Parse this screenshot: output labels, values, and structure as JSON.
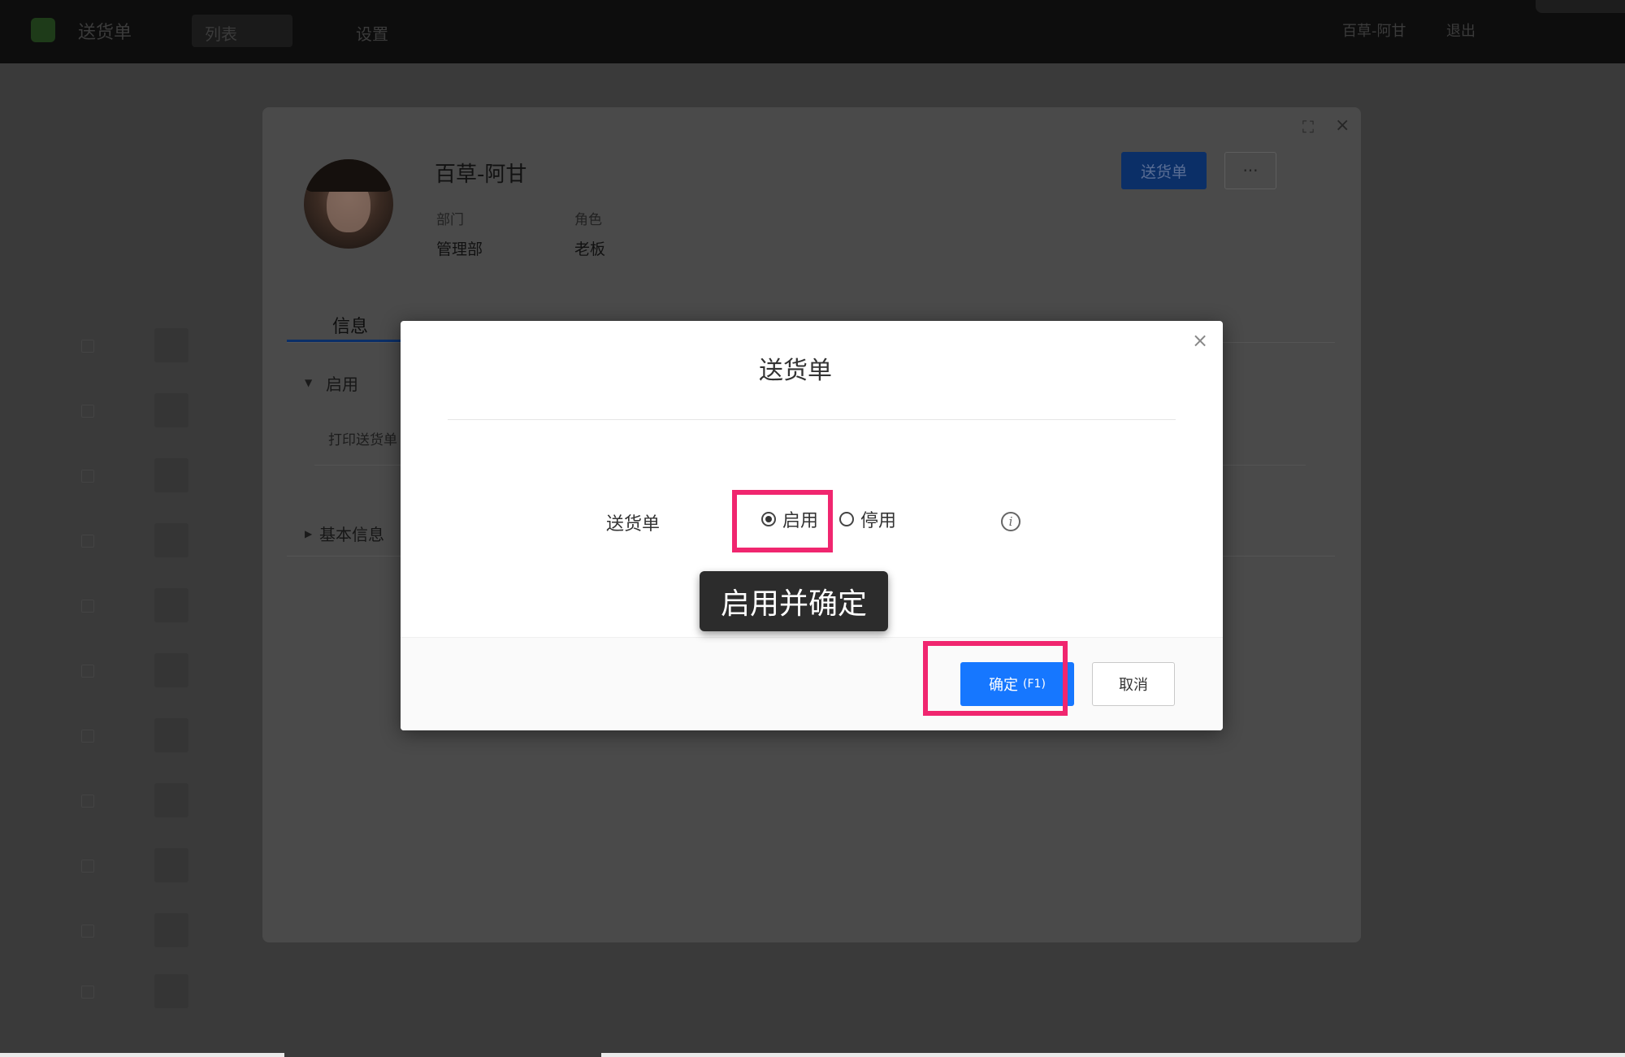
{
  "app": {
    "name": "送货单",
    "tabs": [
      "列表",
      "设置"
    ],
    "user": "百草-阿甘",
    "logout": "退出"
  },
  "panel": {
    "name": "百草-阿甘",
    "department_label": "部门",
    "department_value": "管理部",
    "role_label": "角色",
    "role_value": "老板",
    "primary_button": "送货单",
    "more_button": "···",
    "tab": "信息",
    "section_enabled": "启用",
    "item_print": "打印送货单",
    "section_basic": "基本信息"
  },
  "modal": {
    "title": "送货单",
    "close": "×",
    "field_label": "送货单",
    "options": [
      {
        "label": "启用",
        "selected": true
      },
      {
        "label": "停用",
        "selected": false
      }
    ],
    "info_icon": "i",
    "confirm_label": "确定",
    "confirm_hotkey": "(F1)",
    "cancel_label": "取消"
  },
  "annotation": {
    "callout": "启用并确定",
    "highlight_color": "#f0266f"
  },
  "colors": {
    "primary": "#1677ff",
    "overlay": "#3a3a3a"
  }
}
